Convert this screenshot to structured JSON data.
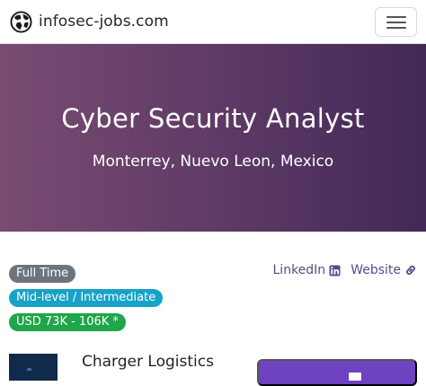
{
  "navbar": {
    "brand": "infosec-jobs.com",
    "logo_icon": "globe-spy-logo",
    "menu_icon": "hamburger-menu-icon"
  },
  "hero": {
    "title": "Cyber Security Analyst",
    "location": "Monterrey, Nuevo Leon, Mexico",
    "gradient_start": "#7a4b72",
    "gradient_end": "#432857"
  },
  "badges": {
    "employment_type": "Full Time",
    "level": "Mid-level / Intermediate",
    "salary": "USD 73K - 106K *"
  },
  "links": {
    "linkedin": "LinkedIn",
    "linkedin_icon": "linkedin-icon",
    "website": "Website",
    "website_icon": "link-icon",
    "link_color": "#5a4a8c"
  },
  "company": {
    "name": "Charger Logistics"
  },
  "apply": {
    "button_color": "#6f42c1"
  }
}
